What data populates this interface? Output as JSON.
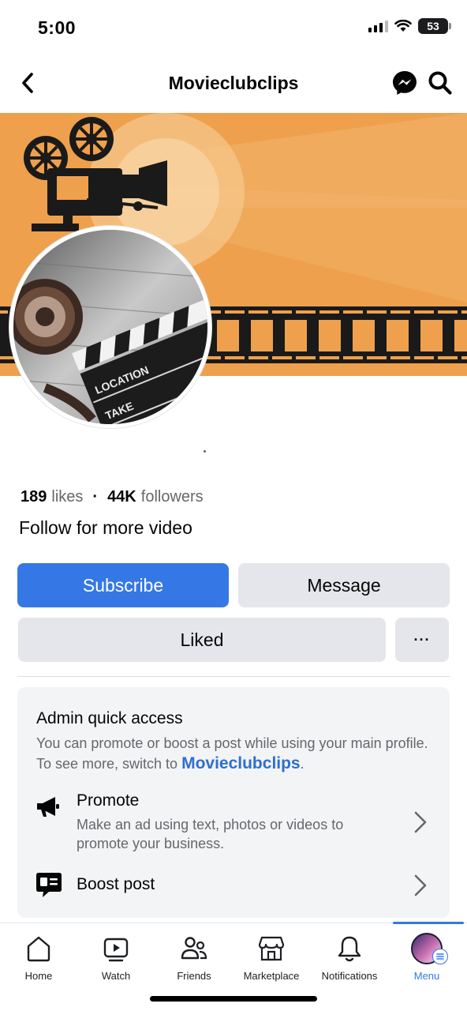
{
  "status_bar": {
    "time": "5:00",
    "battery": "53"
  },
  "header": {
    "title": "Movieclubclips"
  },
  "cover": {
    "colors": {
      "orange": "#efa04c",
      "light": "#f6c58a",
      "dark": "#1a1a1a"
    },
    "avatar_text": {
      "line1": "LOCATION",
      "line2": "TAKE"
    }
  },
  "stats": {
    "likes_count": "189",
    "likes_label": "likes",
    "followers_count": "44K",
    "followers_label": "followers"
  },
  "bio": "Follow for more video",
  "actions": {
    "subscribe": "Subscribe",
    "message": "Message",
    "liked": "Liked",
    "more": "···"
  },
  "admin": {
    "title": "Admin quick access",
    "desc_prefix": "You can promote or boost a post while using your main profile. To see more, switch to ",
    "desc_link": "Movieclubclips",
    "desc_suffix": ".",
    "promote": {
      "title": "Promote",
      "subtitle": "Make an ad using text, photos or videos to promote your business.",
      "icon": "megaphone-icon"
    },
    "boost": {
      "title": "Boost post",
      "icon": "boost-post-icon"
    }
  },
  "nav": [
    {
      "label": "Home",
      "icon": "home-icon"
    },
    {
      "label": "Watch",
      "icon": "watch-icon"
    },
    {
      "label": "Friends",
      "icon": "friends-icon"
    },
    {
      "label": "Marketplace",
      "icon": "marketplace-icon"
    },
    {
      "label": "Notifications",
      "icon": "bell-icon"
    },
    {
      "label": "Menu",
      "icon": "menu-avatar-icon",
      "active": true
    }
  ],
  "accent_color": "#3578e5"
}
